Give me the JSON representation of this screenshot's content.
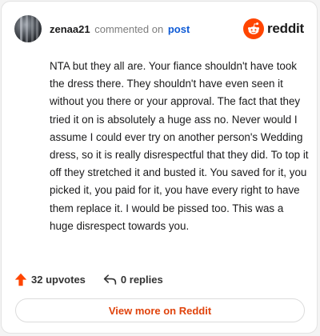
{
  "header": {
    "username": "zenaa21",
    "action_text": "commented on",
    "post_link_text": "post",
    "brand_name": "reddit"
  },
  "comment": {
    "body": "NTA but they all are. Your fiance shouldn't have took the dress there. They shouldn't have even seen it without you there or your approval. The fact that they tried it on is absolutely a huge ass no. Never would I assume I could ever try on another person's Wedding dress, so it is really disrespectful that they did. To top it off they stretched it and busted it. You saved for it, you picked it, you paid for it, you have every right to have them replace it. I would be pissed too. This was a huge disrespect towards you."
  },
  "actions": {
    "upvotes_label": "32 upvotes",
    "replies_label": "0 replies"
  },
  "footer": {
    "view_more_label": "View more on Reddit"
  },
  "icons": {
    "upvote": "upvote-arrow-icon",
    "reply": "reply-arrow-icon",
    "brand": "reddit-snoo-icon"
  },
  "colors": {
    "brand_orange": "#ff4500",
    "upvote_orange": "#ff4500",
    "link_blue": "#0f5bd6",
    "view_more_text": "#e0430c",
    "text_primary": "#1a1a1b",
    "text_secondary": "#7c7c7c"
  }
}
